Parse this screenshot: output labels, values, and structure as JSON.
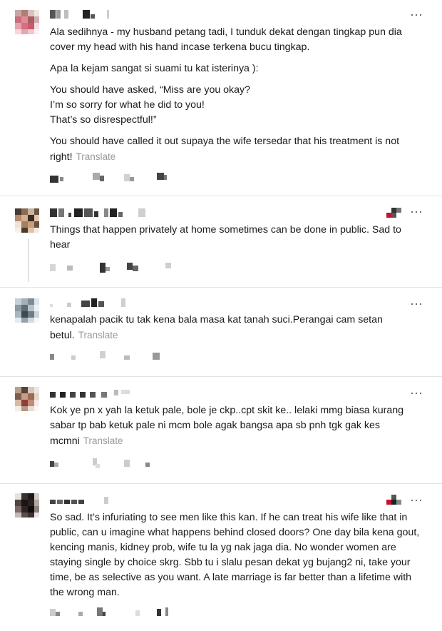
{
  "comments": [
    {
      "paragraphs": [
        "Ala sedihnya - my husband petang tadi, I tunduk dekat dengan tingkap pun dia cover my head with his hand incase terkena bucu tingkap.",
        "Apa la kejam sangat si suami tu kat isterinya ):",
        "You should have asked, “Miss are you okay?",
        "I’m so sorry for what he did to you!",
        "That’s so disrespectful!”",
        "You should have called it out supaya the wife tersedar that his treatment is not right!"
      ],
      "translate": "Translate",
      "more_icon": "⋯"
    },
    {
      "paragraphs": [
        "Things that happen privately at home sometimes can be done in public. Sad to hear"
      ],
      "more_icon": "⋯"
    },
    {
      "paragraphs": [
        "kenapalah pacik tu tak kena bala masa kat tanah suci.Perangai cam setan betul."
      ],
      "translate": "Translate",
      "more_icon": "⋯"
    },
    {
      "paragraphs": [
        "Kok ye pn x yah la ketuk pale, bole je ckp..cpt skit ke.. lelaki mmg biasa kurang sabar tp bab ketuk pale ni mcm bole agak bangsa apa sb pnh tgk gak kes mcmni"
      ],
      "translate": "Translate",
      "more_icon": "⋯"
    },
    {
      "paragraphs": [
        "So sad. It’s infuriating to see men like this kan. If he can treat his wife like that in public, can u imagine what happens behind closed doors? One day bila kena gout, kencing manis, kidney prob, wife tu la yg nak jaga dia. No wonder women are staying single by choice skrg. Sbb tu i slalu pesan dekat yg bujang2 ni, take your time, be as selective as you want. A late marriage is far better than a lifetime with the wrong man."
      ],
      "more_icon": "⋯"
    }
  ],
  "colors": {
    "text": "#1a1a1a",
    "muted": "#9a9a9a",
    "divider": "#e4e4e4",
    "flag_red": "#c8102e"
  },
  "icons": {
    "more": "more-options-icon",
    "flag": "pixelated-badge-icon"
  }
}
